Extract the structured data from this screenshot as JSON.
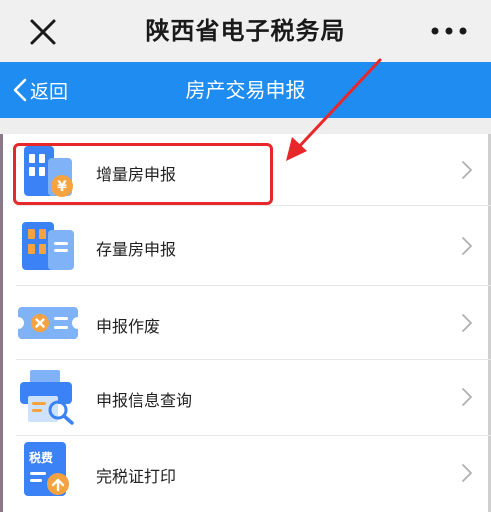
{
  "wechat_bar": {
    "title": "陕西省电子税务局",
    "close_icon": "close-icon",
    "more_icon": "more-icon"
  },
  "app_header": {
    "back_label": "返回",
    "title": "房产交易申报",
    "color": "#1f8cf2"
  },
  "menu": {
    "items": [
      {
        "label": "增量房申报",
        "icon": "new-house-icon",
        "highlighted": true
      },
      {
        "label": "存量房申报",
        "icon": "existing-house-icon"
      },
      {
        "label": "申报作废",
        "icon": "cancel-ticket-icon"
      },
      {
        "label": "申报信息查询",
        "icon": "printer-search-icon"
      },
      {
        "label": "完税证打印",
        "icon": "tax-certificate-print-icon"
      }
    ]
  },
  "annotation": {
    "highlight_color": "#e8272b"
  }
}
